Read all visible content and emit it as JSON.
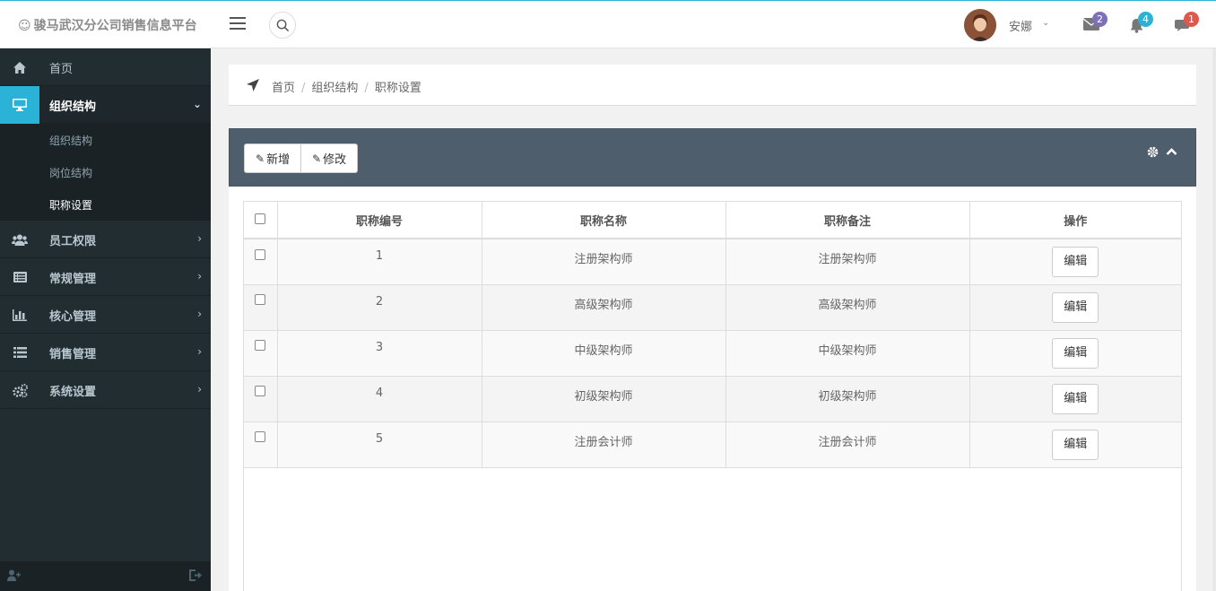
{
  "header": {
    "brand": "骏马武汉分公司销售信息平台",
    "username": "安娜",
    "mail_count": "2",
    "bell_count": "4",
    "chat_count": "1",
    "colors": {
      "accent": "#2ab3d7",
      "mail_badge": "#7e6fb8",
      "bell_badge": "#2ab3d7",
      "chat_badge": "#e2574c"
    }
  },
  "sidebar": {
    "items": [
      {
        "label": "首页",
        "icon": "home-icon"
      },
      {
        "label": "组织结构",
        "icon": "desktop-icon"
      },
      {
        "label": "员工权限",
        "icon": "users-icon"
      },
      {
        "label": "常规管理",
        "icon": "list-alt-icon"
      },
      {
        "label": "核心管理",
        "icon": "bar-chart-icon"
      },
      {
        "label": "销售管理",
        "icon": "list-icon"
      },
      {
        "label": "系统设置",
        "icon": "cogs-icon"
      }
    ],
    "sub_items": [
      {
        "label": "组织结构"
      },
      {
        "label": "岗位结构"
      },
      {
        "label": "职称设置"
      }
    ]
  },
  "breadcrumb": [
    "首页",
    "组织结构",
    "职称设置"
  ],
  "toolbar": {
    "add_label": "新增",
    "edit_label": "修改"
  },
  "table": {
    "columns": [
      "职称编号",
      "职称名称",
      "职称备注",
      "操作"
    ],
    "rows": [
      {
        "id": "1",
        "name": "注册架构师",
        "remark": "注册架构师",
        "action": "编辑"
      },
      {
        "id": "2",
        "name": "高级架构师",
        "remark": "高级架构师",
        "action": "编辑"
      },
      {
        "id": "3",
        "name": "中级架构师",
        "remark": "中级架构师",
        "action": "编辑"
      },
      {
        "id": "4",
        "name": "初级架构师",
        "remark": "初级架构师",
        "action": "编辑"
      },
      {
        "id": "5",
        "name": "注册会计师",
        "remark": "注册会计师",
        "action": "编辑"
      }
    ]
  }
}
